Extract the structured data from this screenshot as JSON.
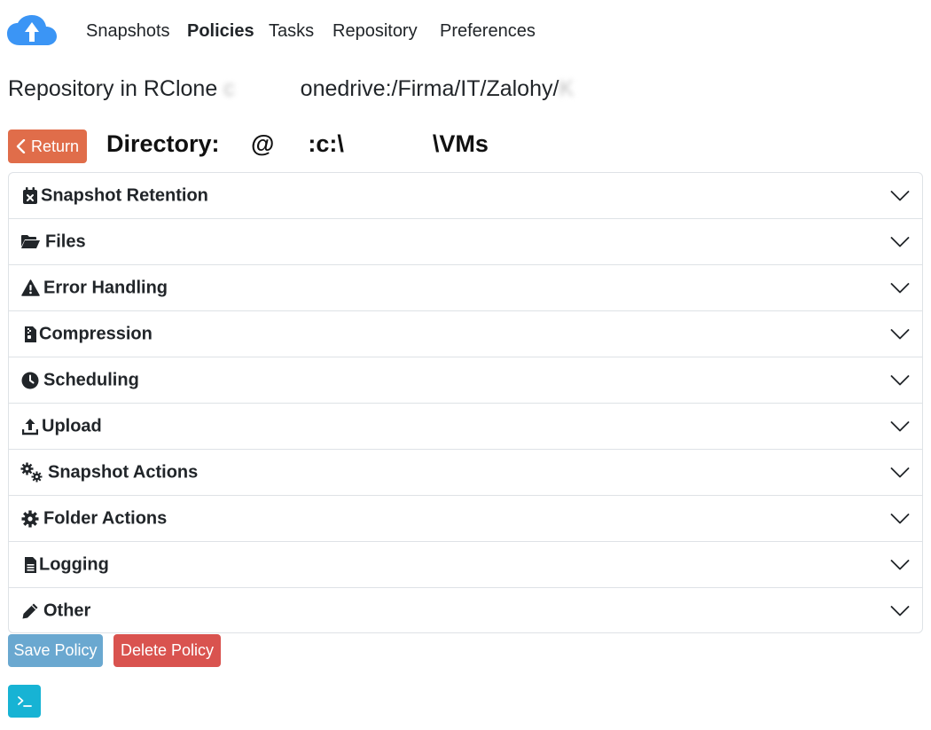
{
  "nav": {
    "links": [
      {
        "label": "Snapshots"
      },
      {
        "label": "Policies"
      },
      {
        "label": "Tasks"
      },
      {
        "label": "Repository"
      },
      {
        "label": "Preferences"
      }
    ],
    "active": "Policies"
  },
  "repository": {
    "prefix": "Repository in RClone ",
    "redacted_1": "c",
    "path_visible": "onedrive:/Firma/IT/Zalohy/",
    "redacted_2": "K"
  },
  "directory": {
    "prefix": "Directory: ",
    "redacted_1": "",
    "at": "@",
    "redacted_2": "",
    "drive": ":c:\\",
    "redacted_3": "",
    "suffix": "\\VMs"
  },
  "return_label": "Return",
  "sections": [
    {
      "label": "Snapshot Retention",
      "icon": "calendar-x-icon"
    },
    {
      "label": "Files",
      "icon": "folder-open-icon"
    },
    {
      "label": "Error Handling",
      "icon": "warning-icon"
    },
    {
      "label": "Compression",
      "icon": "file-zipper-icon"
    },
    {
      "label": "Scheduling",
      "icon": "clock-icon"
    },
    {
      "label": "Upload",
      "icon": "upload-icon"
    },
    {
      "label": "Snapshot Actions",
      "icon": "gears-icon"
    },
    {
      "label": "Folder Actions",
      "icon": "gear-icon"
    },
    {
      "label": "Logging",
      "icon": "file-lines-icon"
    },
    {
      "label": "Other",
      "icon": "pencil-icon"
    }
  ],
  "actions": {
    "save_label": "Save Policy",
    "delete_label": "Delete Policy"
  },
  "colors": {
    "return": "#e06d4a",
    "save": "#6aa8d0",
    "delete": "#d9534f",
    "terminal": "#17b3d4",
    "logo": "#3b95f5"
  }
}
